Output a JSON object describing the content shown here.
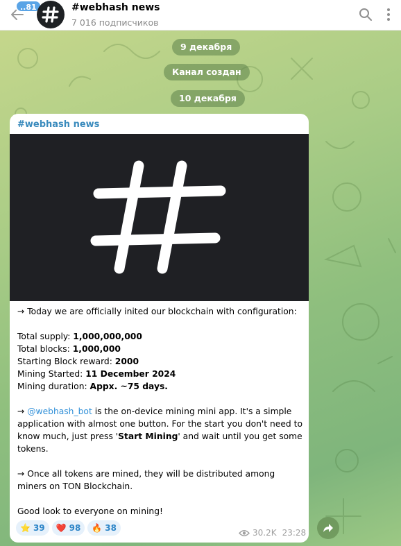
{
  "header": {
    "unread_count": "..81",
    "title": "#webhash news",
    "subscribers": "7 016 подписчиков"
  },
  "service": {
    "date1": "9 декабря",
    "created": "Канал создан",
    "date2": "10 декабря"
  },
  "message": {
    "author": "#webhash news",
    "intro": "→ Today we are officially inited our blockchain with configuration:",
    "config": [
      {
        "label": "Total supply: ",
        "value": "1,000,000,000"
      },
      {
        "label": "Total blocks: ",
        "value": "1,000,000"
      },
      {
        "label": "Starting Block reward: ",
        "value": "2000"
      },
      {
        "label": "Mining Started: ",
        "value": "11 December 2024"
      },
      {
        "label": "Mining duration: ",
        "value": "Appx. ~75 days."
      }
    ],
    "p2_arrow": "→ ",
    "p2_link": "@webhash_bot",
    "p2_a": " is the on-device mining mini app. It's a simple application with almost one button. For the start you don't need to know much, just press '",
    "p2_bold": "Start Mining",
    "p2_b": "' and wait until you get some tokens.",
    "p3": "→ Once all tokens are mined, they will be distributed among miners on TON Blockchain.",
    "p4": "Good look to everyone on mining!",
    "reactions": [
      {
        "emoji": "⭐",
        "count": "39"
      },
      {
        "emoji": "❤️",
        "count": "98"
      },
      {
        "emoji": "🔥",
        "count": "38"
      }
    ],
    "views": "30.2K",
    "time": "23:28"
  },
  "icons": {
    "back": "arrow-left-icon",
    "search": "search-icon",
    "menu": "more-vertical-icon",
    "views": "eye-icon",
    "share": "share-arrow-icon"
  },
  "colors": {
    "link": "#2f8fd8",
    "author": "#3a8bbd",
    "badge": "#5aa4e6",
    "image_bg": "#1f2024"
  }
}
